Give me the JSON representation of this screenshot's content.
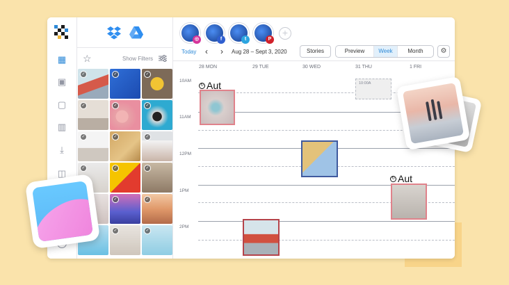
{
  "sidebar": {
    "items": [
      {
        "name": "calendar-icon",
        "glyph": "▦",
        "active": true
      },
      {
        "name": "image-icon",
        "glyph": "▣",
        "active": false
      },
      {
        "name": "chat-icon",
        "glyph": "▢",
        "active": false
      },
      {
        "name": "analytics-icon",
        "glyph": "▥",
        "active": false
      },
      {
        "name": "download-icon",
        "glyph": "⤓",
        "active": false
      },
      {
        "name": "team-icon",
        "glyph": "◫",
        "active": false
      },
      {
        "name": "help-icon",
        "glyph": "?",
        "active": false
      }
    ]
  },
  "media": {
    "show_filters": "Show Filters"
  },
  "accounts": [
    {
      "network": "instagram",
      "badge": "◎",
      "color": "#d6349a"
    },
    {
      "network": "facebook",
      "badge": "f",
      "color": "#2f5fd0"
    },
    {
      "network": "twitter",
      "badge": "t",
      "color": "#2ca5e0"
    },
    {
      "network": "pinterest",
      "badge": "P",
      "color": "#d1202a"
    }
  ],
  "toolbar": {
    "today": "Today",
    "prev": "‹",
    "next": "›",
    "date_range": "Aug 28 – Sept 3, 2020",
    "stories": "Stories",
    "preview": "Preview",
    "week": "Week",
    "month": "Month",
    "settings_glyph": "⚙"
  },
  "days": [
    "28 MON",
    "29 TUE",
    "30 WED",
    "31 THU",
    "1 FRI"
  ],
  "times": [
    "10AM",
    "11AM",
    "12PM",
    "1PM",
    "2PM"
  ],
  "ghost_slot": "10:00A",
  "auto_label": "Aut",
  "colors": {
    "accent": "#2e8ad8",
    "post_red": "#e0828b",
    "post_blue": "#3f5a9e",
    "post_darkred": "#b5434a"
  }
}
